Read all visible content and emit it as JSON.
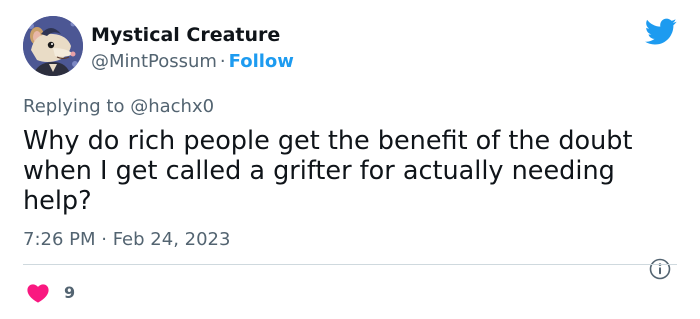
{
  "tweet": {
    "author": {
      "display_name": "Mystical Creature",
      "handle": "@MintPossum",
      "separator": "·",
      "follow_label": "Follow",
      "avatar_icon": "possum-avatar"
    },
    "platform_icon": "twitter-bird-icon",
    "reply_prefix": "Replying to",
    "reply_to": "@hachx0",
    "text": "Why do rich people get the benefit of the doubt when I get called a grifter for actually needing help?",
    "timestamp": "7:26 PM · Feb 24, 2023",
    "info_icon": "info-icon",
    "likes": {
      "icon": "heart-icon",
      "count": "9"
    }
  },
  "colors": {
    "accent": "#1d9bf0",
    "text": "#0f1419",
    "secondary": "#536471",
    "heart": "#f91880",
    "divider": "#cfd9de"
  }
}
